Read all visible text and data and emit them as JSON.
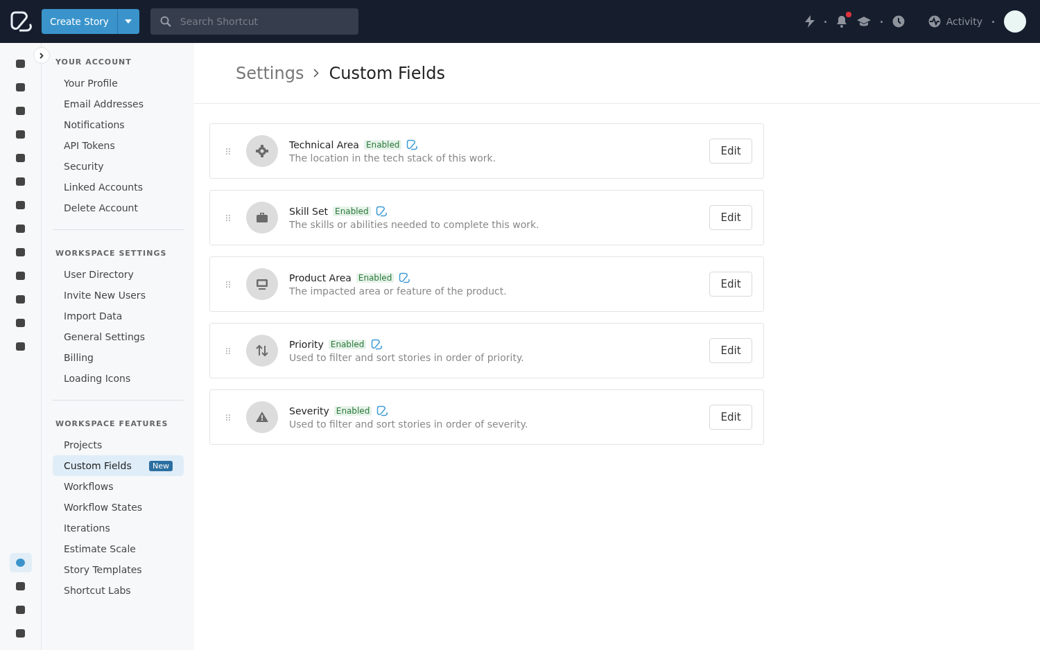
{
  "topbar": {
    "create_button": "Create Story",
    "search": {
      "placeholder": "Search Shortcut"
    },
    "activity": "Activity",
    "notification_dot": true
  },
  "rail": [
    {
      "selected": false
    },
    {
      "selected": false
    },
    {
      "selected": false
    },
    {
      "selected": false
    },
    {
      "selected": false
    },
    {
      "selected": false
    },
    {
      "selected": false
    },
    {
      "selected": false
    },
    {
      "selected": false
    },
    {
      "selected": false
    },
    {
      "selected": false
    },
    {
      "selected": false
    },
    {
      "selected": false
    }
  ],
  "rail_bottom": [
    {
      "selected": true
    },
    {
      "selected": false
    },
    {
      "selected": false
    },
    {
      "selected": false
    }
  ],
  "sidebar": {
    "sections": [
      {
        "title": "YOUR ACCOUNT",
        "items": [
          {
            "label": "Your Profile",
            "selected": false
          },
          {
            "label": "Email Addresses",
            "selected": false
          },
          {
            "label": "Notifications",
            "selected": false
          },
          {
            "label": "API Tokens",
            "selected": false
          },
          {
            "label": "Security",
            "selected": false
          },
          {
            "label": "Linked Accounts",
            "selected": false
          },
          {
            "label": "Delete Account",
            "selected": false
          }
        ]
      },
      {
        "title": "WORKSPACE SETTINGS",
        "items": [
          {
            "label": "User Directory",
            "selected": false
          },
          {
            "label": "Invite New Users",
            "selected": false
          },
          {
            "label": "Import Data",
            "selected": false
          },
          {
            "label": "General Settings",
            "selected": false
          },
          {
            "label": "Billing",
            "selected": false
          },
          {
            "label": "Loading Icons",
            "selected": false
          }
        ]
      },
      {
        "title": "WORKSPACE FEATURES",
        "items": [
          {
            "label": "Projects",
            "selected": false
          },
          {
            "label": "Custom Fields",
            "selected": true,
            "badge": "New"
          },
          {
            "label": "Workflows",
            "selected": false
          },
          {
            "label": "Workflow States",
            "selected": false
          },
          {
            "label": "Iterations",
            "selected": false
          },
          {
            "label": "Estimate Scale",
            "selected": false
          },
          {
            "label": "Story Templates",
            "selected": false
          },
          {
            "label": "Shortcut Labs",
            "selected": false
          }
        ]
      }
    ]
  },
  "breadcrumb": {
    "parent": "Settings",
    "current": "Custom Fields"
  },
  "fields": [
    {
      "name": "Technical Area",
      "status": "Enabled",
      "description": "The location in the tech stack of this work.",
      "button": "Edit"
    },
    {
      "name": "Skill Set",
      "status": "Enabled",
      "description": "The skills or abilities needed to complete this work.",
      "button": "Edit"
    },
    {
      "name": "Product Area",
      "status": "Enabled",
      "description": "The impacted area or feature of the product.",
      "button": "Edit"
    },
    {
      "name": "Priority",
      "status": "Enabled",
      "description": "Used to filter and sort stories in order of priority.",
      "button": "Edit"
    },
    {
      "name": "Severity",
      "status": "Enabled",
      "description": "Used to filter and sort stories in order of severity.",
      "button": "Edit"
    }
  ]
}
